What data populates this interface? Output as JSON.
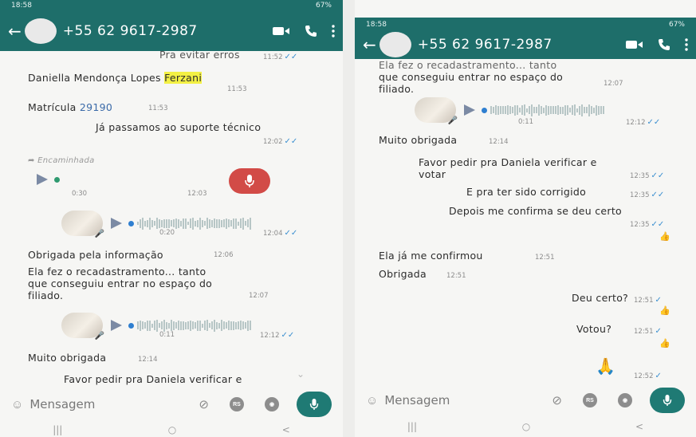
{
  "colors": {
    "header_bg": "#1e6e6a",
    "read_ticks": "#3b8fd0",
    "highlight": "#f3f044",
    "record_button": "#d24b47",
    "send_button": "#1f7a74"
  },
  "icons": [
    "back-arrow-icon",
    "video-call-icon",
    "phone-icon",
    "more-options-icon",
    "play-icon",
    "mic-icon",
    "emoji-icon",
    "attach-icon",
    "rs-icon",
    "camera-icon",
    "forward-icon",
    "chevron-down-icon"
  ],
  "left": {
    "status": {
      "time": "18:58",
      "battery": "67%"
    },
    "header": {
      "contact": "+55 62 9617-2987"
    },
    "messages": {
      "m0_text": "Pra evitar erros",
      "m0_time": "11:52",
      "m1_name": "Daniella Mendonça  Lopes ",
      "m1_highlight": "Ferzani",
      "m1_time": "11:53",
      "m2_label": "Matrícula ",
      "m2_value": "29190",
      "m2_time": "11:53",
      "m3_text": "Já passamos ao suporte técnico",
      "m3_time": "12:02",
      "fwd_label": "Encaminhada",
      "voice1_duration": "0:30",
      "voice1_time": "12:03",
      "voice2_duration": "0:20",
      "voice2_time": "12:04",
      "m4_text": "Obrigada pela informação",
      "m4_time": "12:06",
      "m5_line1": "Ela fez o recadastramento... tanto",
      "m5_line2": "que conseguiu entrar no espaço do",
      "m5_line3": "filiado.",
      "m5_time": "12:07",
      "voice3_duration": "0:11",
      "voice3_time": "12:12",
      "m6_text": "Muito obrigada",
      "m6_time": "12:14",
      "m7_text": "Favor pedir pra Daniela  verificar e"
    },
    "input": {
      "placeholder": "Mensagem",
      "rs_label": "RS"
    },
    "nav": {
      "recent": "|||",
      "home": "○",
      "back": "<"
    }
  },
  "right": {
    "status": {
      "time": "18:58",
      "battery": "67%"
    },
    "header": {
      "contact": "+55 62 9617-2987"
    },
    "messages": {
      "m1_line1": "Ela fez o recadastramento... tanto",
      "m1_line2": "que conseguiu entrar no espaço do",
      "m1_line3": "filiado.",
      "m1_time": "12:07",
      "voice_duration": "0:11",
      "voice_time": "12:12",
      "m2_text": "Muito obrigada",
      "m2_time": "12:14",
      "m3_line1": "Favor pedir pra Daniela  verificar e",
      "m3_line2": "votar",
      "m3_time": "12:35",
      "m4_text": "E pra ter sido corrigido",
      "m4_time": "12:35",
      "m5_text": "Depois me confirma se deu certo",
      "m5_time": "12:35",
      "m6_text": "Ela já  me confirmou",
      "m6_time": "12:51",
      "m7_text": "Obrigada",
      "m7_time": "12:51",
      "m8_text": "Deu certo?",
      "m8_time": "12:51",
      "m9_text": "Votou?",
      "m9_time": "12:51",
      "m10_time": "12:52"
    },
    "input": {
      "placeholder": "Mensagem",
      "rs_label": "RS"
    },
    "nav": {
      "recent": "|||",
      "home": "○",
      "back": "<"
    }
  }
}
